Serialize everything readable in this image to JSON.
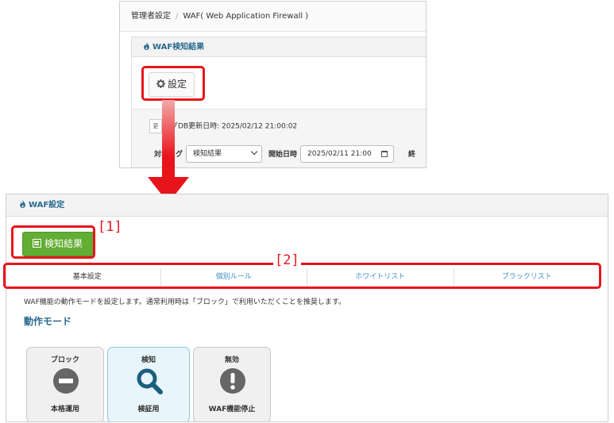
{
  "top": {
    "breadcrumb": {
      "item1": "管理者設定",
      "separator": "/",
      "item2": "WAF( Web Application Firewall )"
    },
    "panel_title": "WAF検知結果",
    "settings_label": "設定",
    "update_button_label": "更",
    "update_text": "ログDB更新日時: 2025/02/12 21:00:02",
    "filter": {
      "target_label": "対象ログ",
      "target_value": "検知結果",
      "start_label": "開始日時",
      "start_value": "2025/02/11 21:00",
      "end_label": "終"
    }
  },
  "bottom": {
    "panel_title": "WAF設定",
    "detect_button_label": "検知結果",
    "tabs": [
      {
        "label": "基本設定",
        "active": true
      },
      {
        "label": "個別ルール",
        "active": false
      },
      {
        "label": "ホワイトリスト",
        "active": false
      },
      {
        "label": "ブラックリスト",
        "active": false
      }
    ],
    "description": "WAF機能の動作モードを設定します。通常利用時は「ブロック」で利用いただくことを推奨します。",
    "mode_title": "動作モード",
    "modes": [
      {
        "title": "ブロック",
        "subtitle": "本格運用",
        "icon": "minus-circle-icon",
        "selected": false
      },
      {
        "title": "検知",
        "subtitle": "検証用",
        "icon": "magnifier-icon",
        "selected": true
      },
      {
        "title": "無効",
        "subtitle": "WAF機能停止",
        "icon": "exclamation-circle-icon",
        "selected": false
      }
    ]
  },
  "callouts": {
    "c1": "[1]",
    "c2": "[2]"
  },
  "colors": {
    "highlight": "#e8141b",
    "accent_green": "#62ad34",
    "link_blue": "#3f8fc4",
    "heading_blue": "#2a6a8e",
    "icon_gray": "#666666",
    "icon_teal": "#1b5f7e"
  }
}
